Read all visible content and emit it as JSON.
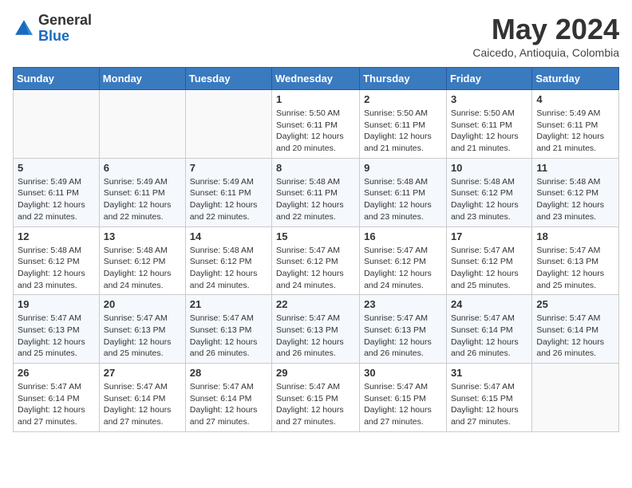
{
  "header": {
    "logo_general": "General",
    "logo_blue": "Blue",
    "month_title": "May 2024",
    "location": "Caicedo, Antioquia, Colombia"
  },
  "weekdays": [
    "Sunday",
    "Monday",
    "Tuesday",
    "Wednesday",
    "Thursday",
    "Friday",
    "Saturday"
  ],
  "weeks": [
    [
      {
        "day": "",
        "info": ""
      },
      {
        "day": "",
        "info": ""
      },
      {
        "day": "",
        "info": ""
      },
      {
        "day": "1",
        "info": "Sunrise: 5:50 AM\nSunset: 6:11 PM\nDaylight: 12 hours and 20 minutes."
      },
      {
        "day": "2",
        "info": "Sunrise: 5:50 AM\nSunset: 6:11 PM\nDaylight: 12 hours and 21 minutes."
      },
      {
        "day": "3",
        "info": "Sunrise: 5:50 AM\nSunset: 6:11 PM\nDaylight: 12 hours and 21 minutes."
      },
      {
        "day": "4",
        "info": "Sunrise: 5:49 AM\nSunset: 6:11 PM\nDaylight: 12 hours and 21 minutes."
      }
    ],
    [
      {
        "day": "5",
        "info": "Sunrise: 5:49 AM\nSunset: 6:11 PM\nDaylight: 12 hours and 22 minutes."
      },
      {
        "day": "6",
        "info": "Sunrise: 5:49 AM\nSunset: 6:11 PM\nDaylight: 12 hours and 22 minutes."
      },
      {
        "day": "7",
        "info": "Sunrise: 5:49 AM\nSunset: 6:11 PM\nDaylight: 12 hours and 22 minutes."
      },
      {
        "day": "8",
        "info": "Sunrise: 5:48 AM\nSunset: 6:11 PM\nDaylight: 12 hours and 22 minutes."
      },
      {
        "day": "9",
        "info": "Sunrise: 5:48 AM\nSunset: 6:11 PM\nDaylight: 12 hours and 23 minutes."
      },
      {
        "day": "10",
        "info": "Sunrise: 5:48 AM\nSunset: 6:12 PM\nDaylight: 12 hours and 23 minutes."
      },
      {
        "day": "11",
        "info": "Sunrise: 5:48 AM\nSunset: 6:12 PM\nDaylight: 12 hours and 23 minutes."
      }
    ],
    [
      {
        "day": "12",
        "info": "Sunrise: 5:48 AM\nSunset: 6:12 PM\nDaylight: 12 hours and 23 minutes."
      },
      {
        "day": "13",
        "info": "Sunrise: 5:48 AM\nSunset: 6:12 PM\nDaylight: 12 hours and 24 minutes."
      },
      {
        "day": "14",
        "info": "Sunrise: 5:48 AM\nSunset: 6:12 PM\nDaylight: 12 hours and 24 minutes."
      },
      {
        "day": "15",
        "info": "Sunrise: 5:47 AM\nSunset: 6:12 PM\nDaylight: 12 hours and 24 minutes."
      },
      {
        "day": "16",
        "info": "Sunrise: 5:47 AM\nSunset: 6:12 PM\nDaylight: 12 hours and 24 minutes."
      },
      {
        "day": "17",
        "info": "Sunrise: 5:47 AM\nSunset: 6:12 PM\nDaylight: 12 hours and 25 minutes."
      },
      {
        "day": "18",
        "info": "Sunrise: 5:47 AM\nSunset: 6:13 PM\nDaylight: 12 hours and 25 minutes."
      }
    ],
    [
      {
        "day": "19",
        "info": "Sunrise: 5:47 AM\nSunset: 6:13 PM\nDaylight: 12 hours and 25 minutes."
      },
      {
        "day": "20",
        "info": "Sunrise: 5:47 AM\nSunset: 6:13 PM\nDaylight: 12 hours and 25 minutes."
      },
      {
        "day": "21",
        "info": "Sunrise: 5:47 AM\nSunset: 6:13 PM\nDaylight: 12 hours and 26 minutes."
      },
      {
        "day": "22",
        "info": "Sunrise: 5:47 AM\nSunset: 6:13 PM\nDaylight: 12 hours and 26 minutes."
      },
      {
        "day": "23",
        "info": "Sunrise: 5:47 AM\nSunset: 6:13 PM\nDaylight: 12 hours and 26 minutes."
      },
      {
        "day": "24",
        "info": "Sunrise: 5:47 AM\nSunset: 6:14 PM\nDaylight: 12 hours and 26 minutes."
      },
      {
        "day": "25",
        "info": "Sunrise: 5:47 AM\nSunset: 6:14 PM\nDaylight: 12 hours and 26 minutes."
      }
    ],
    [
      {
        "day": "26",
        "info": "Sunrise: 5:47 AM\nSunset: 6:14 PM\nDaylight: 12 hours and 27 minutes."
      },
      {
        "day": "27",
        "info": "Sunrise: 5:47 AM\nSunset: 6:14 PM\nDaylight: 12 hours and 27 minutes."
      },
      {
        "day": "28",
        "info": "Sunrise: 5:47 AM\nSunset: 6:14 PM\nDaylight: 12 hours and 27 minutes."
      },
      {
        "day": "29",
        "info": "Sunrise: 5:47 AM\nSunset: 6:15 PM\nDaylight: 12 hours and 27 minutes."
      },
      {
        "day": "30",
        "info": "Sunrise: 5:47 AM\nSunset: 6:15 PM\nDaylight: 12 hours and 27 minutes."
      },
      {
        "day": "31",
        "info": "Sunrise: 5:47 AM\nSunset: 6:15 PM\nDaylight: 12 hours and 27 minutes."
      },
      {
        "day": "",
        "info": ""
      }
    ]
  ]
}
